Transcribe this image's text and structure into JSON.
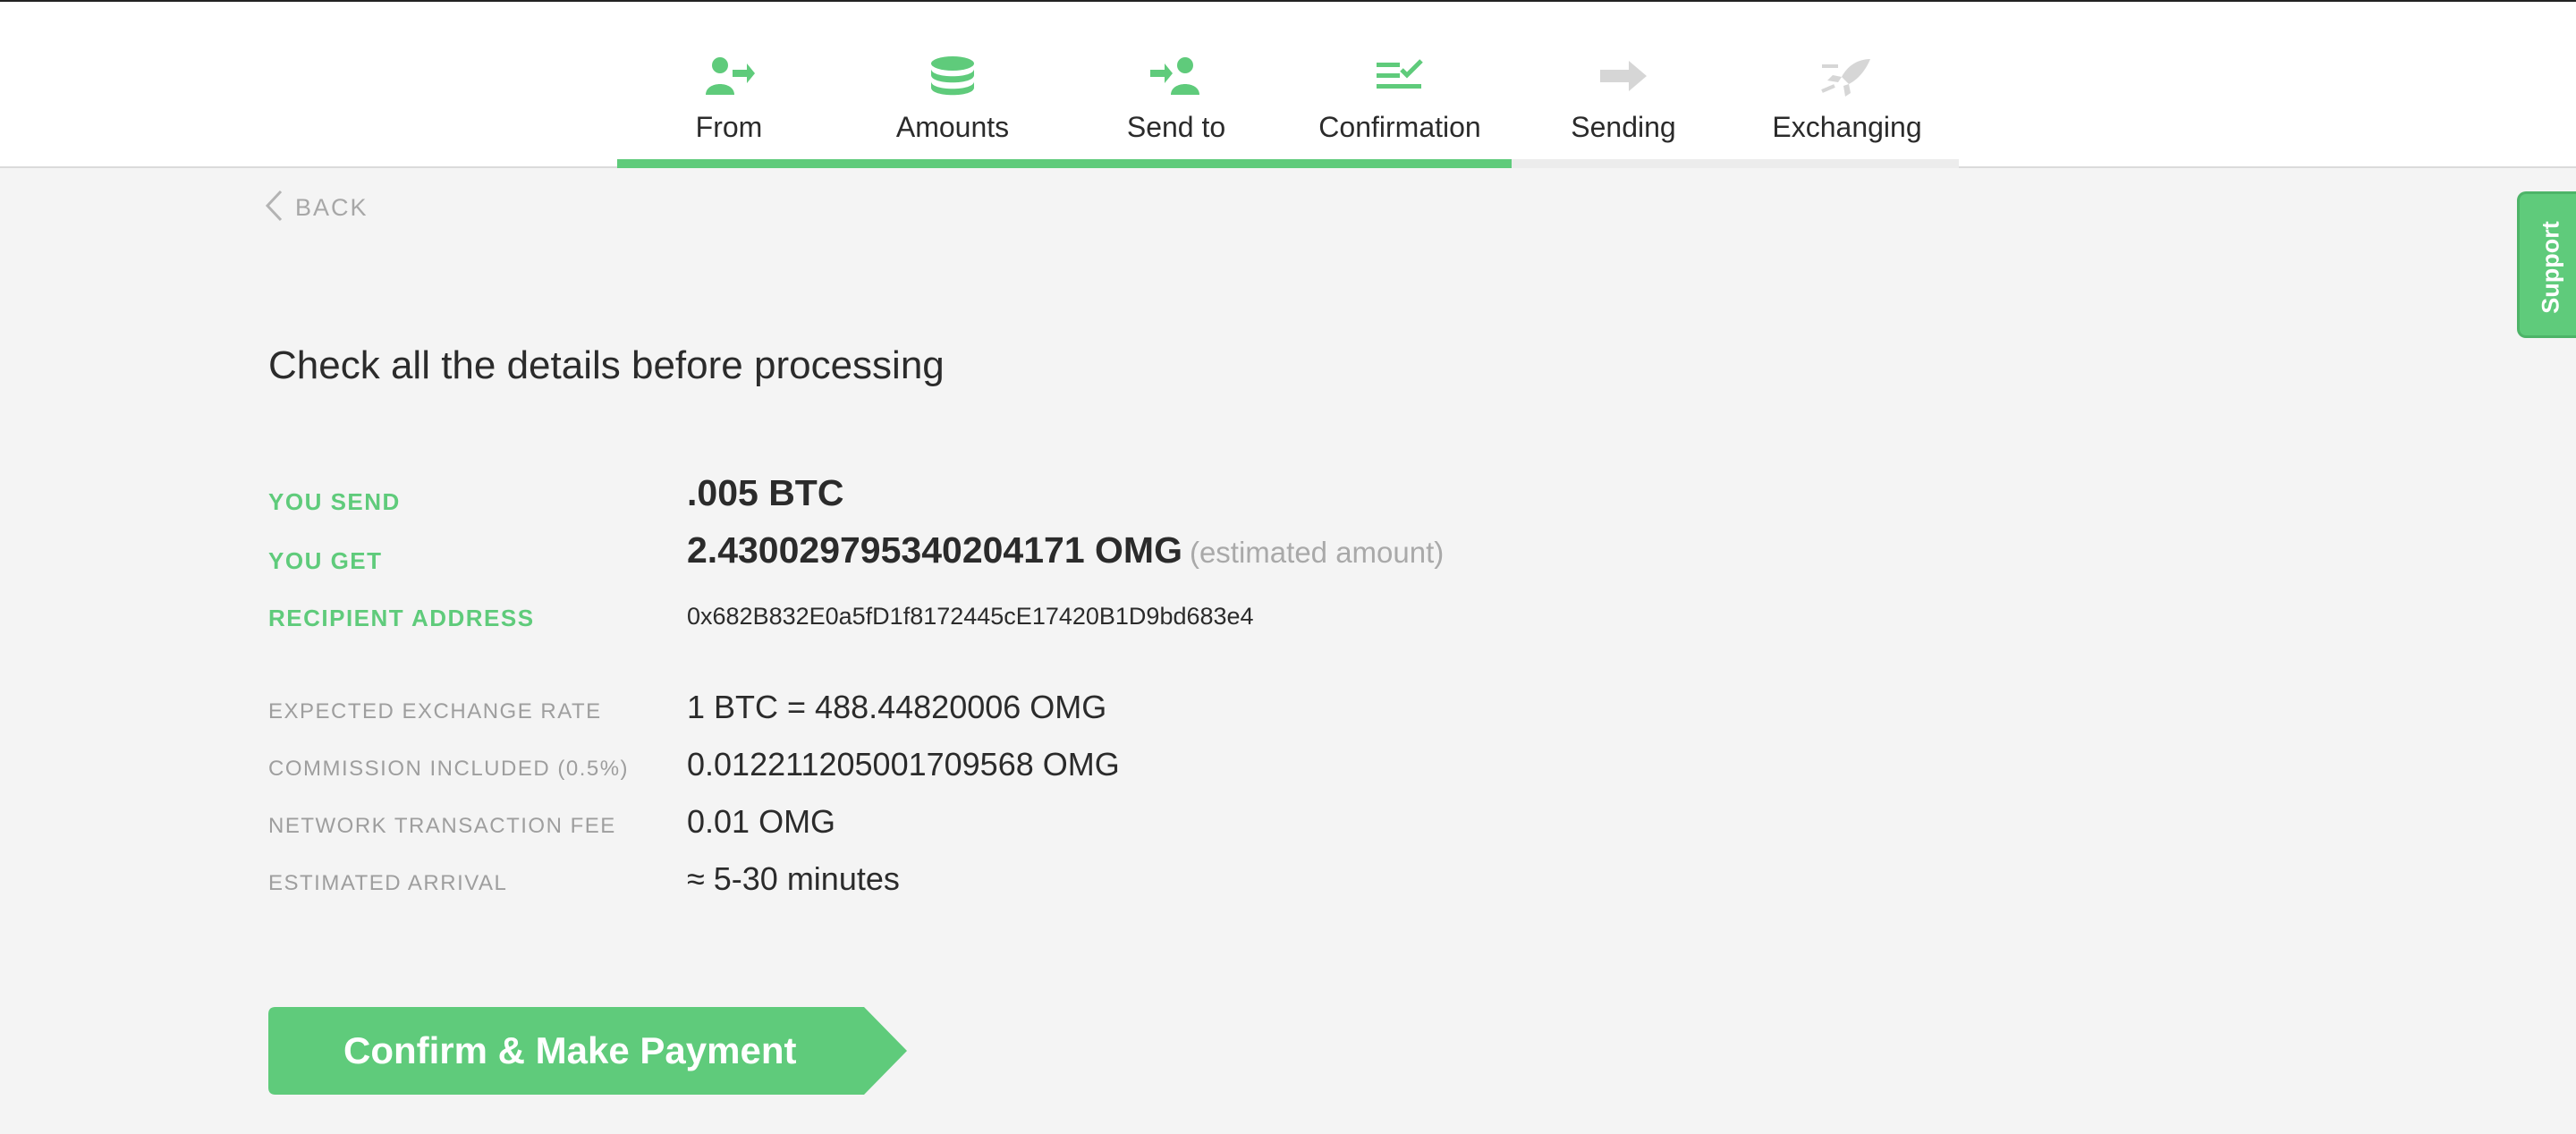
{
  "stepper": {
    "steps": [
      {
        "label": "From",
        "icon": "user-arrow-icon",
        "active": true
      },
      {
        "label": "Amounts",
        "icon": "coin-stack-icon",
        "active": true
      },
      {
        "label": "Send to",
        "icon": "arrow-user-icon",
        "active": true
      },
      {
        "label": "Confirmation",
        "icon": "checklist-icon",
        "active": true
      },
      {
        "label": "Sending",
        "icon": "arrow-right-icon",
        "active": false
      },
      {
        "label": "Exchanging",
        "icon": "rocket-icon",
        "active": false
      }
    ],
    "progress_fraction": 0.6667,
    "active_color": "#5fcb7b",
    "inactive_color": "#d6d6d6"
  },
  "back": {
    "label": "BACK"
  },
  "support": {
    "label": "Support"
  },
  "heading": "Check all the details before processing",
  "details": {
    "you_send_label": "YOU SEND",
    "you_send_value": ".005 BTC",
    "you_get_label": "YOU GET",
    "you_get_value": "2.430029795340204171 OMG",
    "you_get_note": "(estimated amount)",
    "recipient_label": "RECIPIENT ADDRESS",
    "recipient_value": "0x682B832E0a5fD1f8172445cE17420B1D9bd683e4",
    "rate_label": "EXPECTED EXCHANGE RATE",
    "rate_value": "1 BTC = 488.44820006 OMG",
    "commission_label": "COMMISSION INCLUDED (0.5%)",
    "commission_value": "0.012211205001709568 OMG",
    "fee_label": "NETWORK TRANSACTION FEE",
    "fee_value": "0.01 OMG",
    "arrival_label": "ESTIMATED ARRIVAL",
    "arrival_value": "≈ 5-30 minutes"
  },
  "confirm": {
    "label": "Confirm & Make Payment"
  },
  "colors": {
    "accent": "#5fcb7b",
    "text": "#2b2b2b",
    "muted": "#9e9e9e",
    "background": "#f4f4f4"
  }
}
